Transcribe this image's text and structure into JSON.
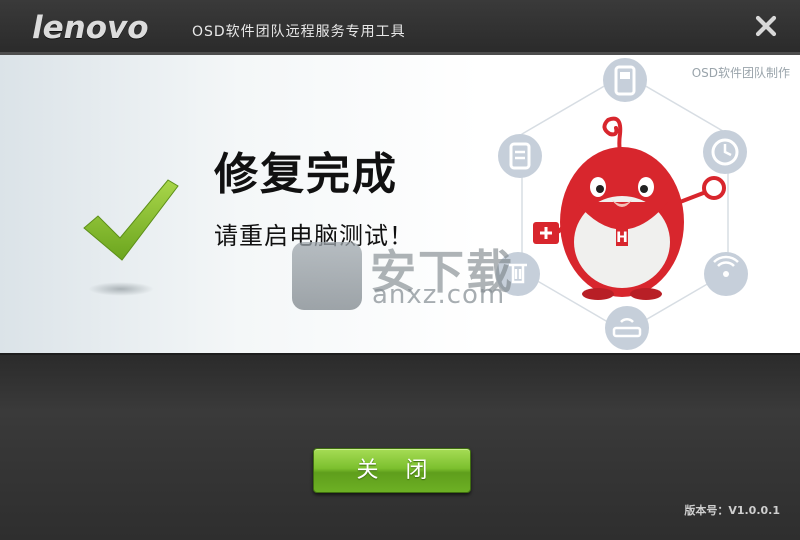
{
  "window": {
    "brand": "lenovo",
    "title": "OSD软件团队远程服务专用工具",
    "close_icon": "close-x-icon"
  },
  "content": {
    "team_made": "OSD软件团队制作",
    "headline": "修复完成",
    "message": "请重启电脑测试！",
    "status_icon": "checkmark-icon",
    "illustration_icons": [
      "mobile-phone-icon",
      "clock-icon",
      "wifi-icon",
      "router-icon",
      "trash-icon",
      "clipboard-icon",
      "first-aid-icon",
      "magnifier-icon",
      "mascot-icon"
    ]
  },
  "watermark": {
    "text": "安下载",
    "url": "anxz.com"
  },
  "footer": {
    "close_button": "关 闭",
    "version": "版本号：V1.0.0.1"
  },
  "colors": {
    "accent_green": "#7cc02e",
    "check_green": "#86c12b",
    "mascot_red": "#d8262d"
  }
}
